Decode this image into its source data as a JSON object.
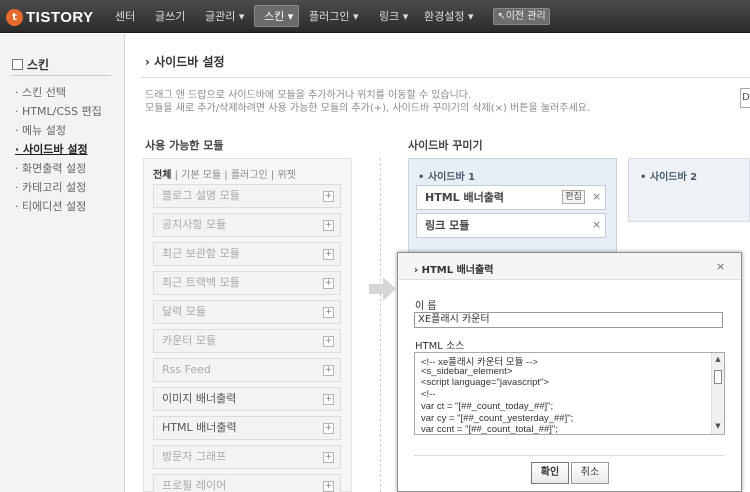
{
  "top_nav": {
    "logo": "TISTORY",
    "items": [
      "센터",
      "글쓰기",
      "글관리",
      "스킨",
      "플러그인",
      "링크",
      "환경설정"
    ],
    "prev_manage": "이전 관리"
  },
  "sidebar": {
    "title": "스킨",
    "items": [
      "스킨 선택",
      "HTML/CSS 편집",
      "메뉴 설정",
      "사이드바 설정",
      "화면출력 설정",
      "카테고리 설정",
      "티에디션 설정"
    ],
    "active_index": 3
  },
  "main": {
    "title": "사이드바 설정",
    "desc1": "드래그 앤 드랍으로 사이드바에 모듈을 추가하거나 위치를 이동할 수 있습니다.",
    "desc2": "모듈을 새로 추가/삭제하려면 사용 가능한 모듈의 추가(+), 사이드바 꾸미기의 삭제(×) 버튼을 눌러주세요.",
    "right_stub": "D"
  },
  "available": {
    "title": "사용 가능한 모듈",
    "filters": [
      "전체",
      "기본 모듈",
      "플러그인",
      "위젯"
    ],
    "modules": [
      {
        "name": "블로그 설명 모듈",
        "highlight": false
      },
      {
        "name": "공지사항 모듈",
        "highlight": false
      },
      {
        "name": "최근 보관함 모듈",
        "highlight": false
      },
      {
        "name": "최근 트랙백 모듈",
        "highlight": false
      },
      {
        "name": "달력 모듈",
        "highlight": false
      },
      {
        "name": "카운터 모듈",
        "highlight": false
      },
      {
        "name": "Rss Feed",
        "highlight": false
      },
      {
        "name": "이미지 배너출력",
        "highlight": true
      },
      {
        "name": "HTML 배너출력",
        "highlight": true
      },
      {
        "name": "방문자 그래프",
        "highlight": false
      },
      {
        "name": "프로필 레이어",
        "highlight": false
      }
    ],
    "plus": "+"
  },
  "decorate": {
    "title": "사이드바 꾸미기",
    "sidebar1": "사이드바 1",
    "sidebar2": "사이드바 2",
    "slots": [
      "HTML 배너출력",
      "링크 모듈"
    ],
    "edit": "편집",
    "remove": "×"
  },
  "dialog": {
    "title": "HTML 배너출력",
    "close": "×",
    "name_label": "이 름",
    "name_value": "XE플래시 카운터",
    "source_label": "HTML 소스",
    "source_lines": [
      "<!-- xe플래시 카운터 모듈 -->",
      "<s_sidebar_element>",
      "<script language=\"javascript\">",
      "<!--",
      "var ct = \"[##_count_today_##]\";",
      "var cy = \"[##_count_yesterday_##]\";",
      "var ccnt = \"[##_count_total_##]\";"
    ],
    "ok": "확인",
    "cancel": "취소"
  },
  "colors": {
    "topbar": "#3a3a3a",
    "logo_accent": "#e66a2c",
    "sidebar_panel": "#e8eef5"
  }
}
